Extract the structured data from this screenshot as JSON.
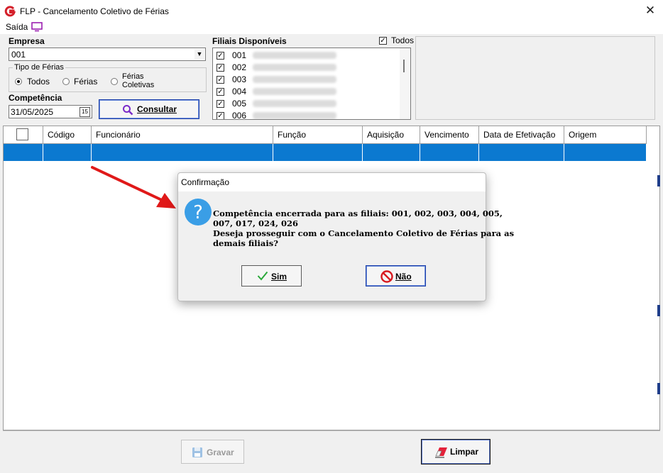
{
  "window": {
    "title": "FLP - Cancelamento Coletivo de Férias"
  },
  "menu": {
    "saida_label": "Saída"
  },
  "empresa": {
    "label": "Empresa",
    "value": "001"
  },
  "tipo_ferias": {
    "legend": "Tipo de Férias",
    "options": [
      {
        "label": "Todos",
        "selected": true
      },
      {
        "label": "Férias",
        "selected": false
      },
      {
        "label_line1": "Férias",
        "label_line2": "Coletivas",
        "selected": false
      }
    ]
  },
  "competencia": {
    "label": "Competência",
    "value": "31/05/2025",
    "calendar_button": "15"
  },
  "consultar_button": "Consultar",
  "filiais": {
    "label": "Filiais Disponíveis",
    "todos_label": "Todos",
    "todos_checked": true,
    "items": [
      {
        "code": "001",
        "checked": true
      },
      {
        "code": "002",
        "checked": true
      },
      {
        "code": "003",
        "checked": true
      },
      {
        "code": "004",
        "checked": true
      },
      {
        "code": "005",
        "checked": true
      },
      {
        "code": "006",
        "checked": true
      }
    ]
  },
  "grid": {
    "columns": [
      "Código",
      "Funcionário",
      "Função",
      "Aquisição",
      "Vencimento",
      "Data de Efetivação",
      "Origem"
    ]
  },
  "buttons": {
    "gravar": "Gravar",
    "limpar": "Limpar"
  },
  "dialog": {
    "title": "Confirmação",
    "line1": "Competência encerrada para as filiais: 001, 002, 003, 004, 005,",
    "line2": "007, 017, 024, 026",
    "line3": "Deseja prosseguir com o Cancelamento Coletivo de Férias para as",
    "line4": "demais filiais?",
    "yes_button": "Sim",
    "no_button": "Não"
  },
  "colors": {
    "selected_row": "#0b79d0",
    "arrow": "#e01919",
    "question_icon": "#3a9ee6"
  }
}
